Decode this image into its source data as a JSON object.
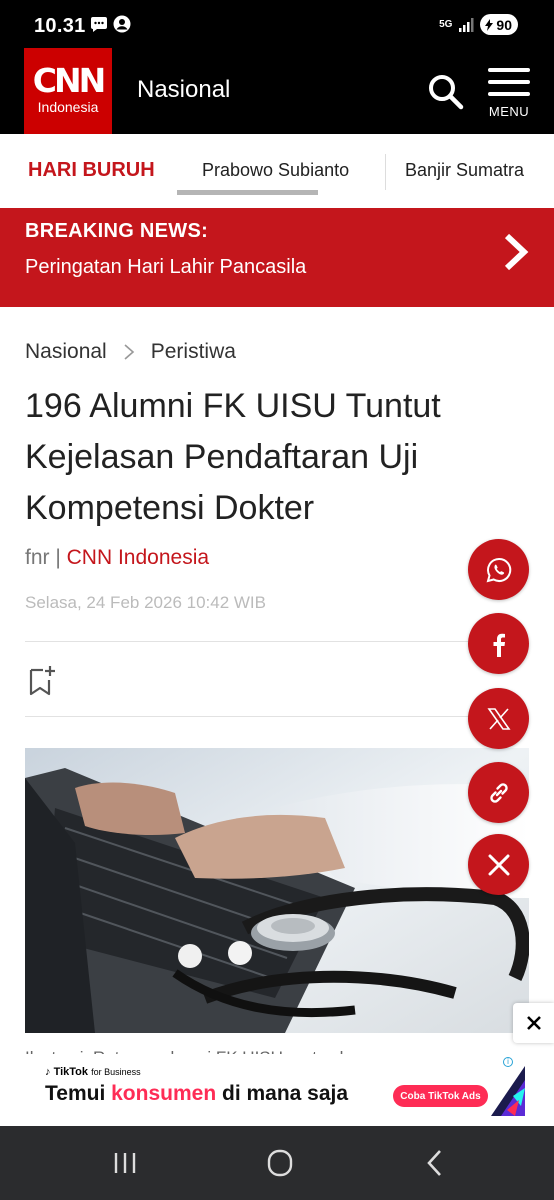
{
  "status_bar": {
    "time": "10.31",
    "network": "5G",
    "battery": "90",
    "icons": [
      "chat-bubble-icon",
      "account-circle-icon",
      "network-5g-icon",
      "signal-icon",
      "battery-icon"
    ]
  },
  "header": {
    "logo_main": "CNN",
    "logo_sub": "Indonesia",
    "section": "Nasional",
    "menu_label": "MENU"
  },
  "topics": {
    "items": [
      "HARI BURUH",
      "Prabowo Subianto",
      "Banjir Sumatra"
    ]
  },
  "breaking": {
    "label": "BREAKING NEWS:",
    "text": "Peringatan Hari Lahir Pancasila"
  },
  "article": {
    "breadcrumb": [
      "Nasional",
      "Peristiwa"
    ],
    "headline": "196 Alumni FK UISU Tuntut Kejelasan Pendaftaran Uji Kompetensi Dokter",
    "author": "fnr",
    "byline_sep": " | ",
    "source": "CNN Indonesia",
    "date": "Selasa, 24 Feb 2026 10:42 WIB",
    "caption": "Ilustrasi. Ratusan alumni FK UISU protes karena"
  },
  "share": {
    "buttons": [
      "whatsapp-icon",
      "facebook-icon",
      "x-icon",
      "link-icon",
      "close-icon"
    ]
  },
  "ad": {
    "brand": "TikTok",
    "brand_suffix": "for Business",
    "headline_pre": "Temui ",
    "headline_accent": "konsumen",
    "headline_post": " di mana saja",
    "cta": "Coba TikTok Ads",
    "info": "i"
  },
  "colors": {
    "brand_red": "#c4161c",
    "cnn_red": "#cc0000",
    "tiktok_pink": "#fe2c55"
  }
}
